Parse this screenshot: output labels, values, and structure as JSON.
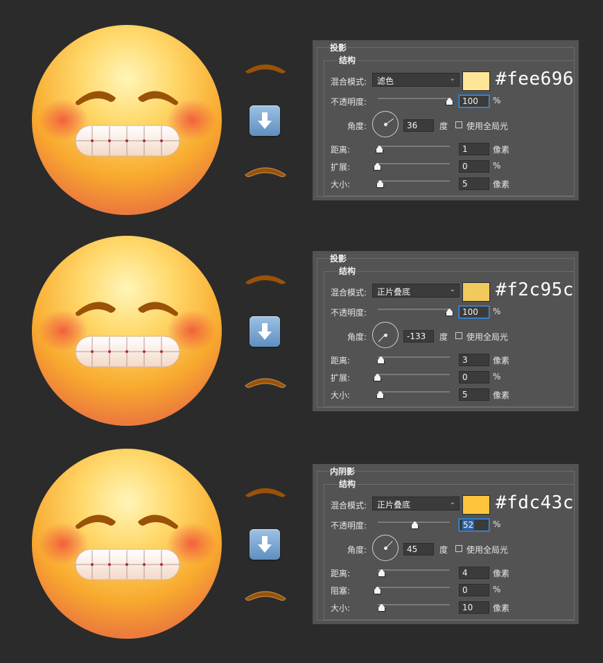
{
  "rows": [
    {
      "section_title": "投影",
      "structure_title": "结构",
      "blend_label": "混合模式:",
      "blend_value": "滤色",
      "swatch_color": "#fee696",
      "hex_text": "#fee696",
      "opacity_label": "不透明度:",
      "opacity_value": "100",
      "opacity_pct": "%",
      "angle_label": "角度:",
      "angle_value": "36",
      "angle_unit": "度",
      "global_light_label": "使用全局光",
      "distance_label": "距离:",
      "distance_value": "1",
      "distance_unit": "像素",
      "spread_label": "扩展:",
      "spread_value": "0",
      "spread_unit": "%",
      "size_label": "大小:",
      "size_value": "5",
      "size_unit": "像素"
    },
    {
      "section_title": "投影",
      "structure_title": "结构",
      "blend_label": "混合模式:",
      "blend_value": "正片叠底",
      "swatch_color": "#f2c95c",
      "hex_text": "#f2c95c",
      "opacity_label": "不透明度:",
      "opacity_value": "100",
      "opacity_pct": "%",
      "angle_label": "角度:",
      "angle_value": "-133",
      "angle_unit": "度",
      "global_light_label": "使用全局光",
      "distance_label": "距离:",
      "distance_value": "3",
      "distance_unit": "像素",
      "spread_label": "扩展:",
      "spread_value": "0",
      "spread_unit": "%",
      "size_label": "大小:",
      "size_value": "5",
      "size_unit": "像素"
    },
    {
      "section_title": "内阴影",
      "structure_title": "结构",
      "blend_label": "混合模式:",
      "blend_value": "正片叠底",
      "swatch_color": "#fdc43c",
      "hex_text": "#fdc43c",
      "opacity_label": "不透明度:",
      "opacity_value": "52",
      "opacity_pct": "%",
      "angle_label": "角度:",
      "angle_value": "45",
      "angle_unit": "度",
      "global_light_label": "使用全局光",
      "distance_label": "距离:",
      "distance_value": "4",
      "distance_unit": "像素",
      "spread_label": "阻塞:",
      "spread_value": "0",
      "spread_unit": "%",
      "size_label": "大小:",
      "size_value": "10",
      "size_unit": "像素"
    }
  ],
  "colors": {
    "background": "#2b2b2b",
    "panel": "#535353",
    "brow": "#9a5208",
    "arrow": "#6f9bcb"
  }
}
